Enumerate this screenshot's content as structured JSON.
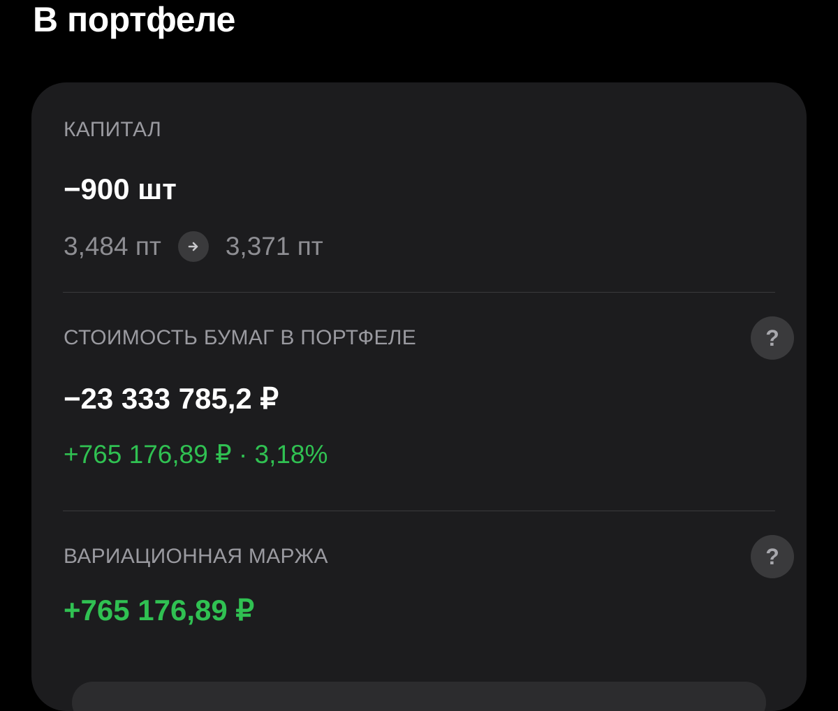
{
  "page": {
    "title": "В портфеле"
  },
  "capital": {
    "label": "КАПИТАЛ",
    "quantity": "−900 шт",
    "from_points": "3,484 пт",
    "to_points": "3,371 пт",
    "arrow_icon": "arrow-right-icon"
  },
  "securities_value": {
    "label": "СТОИМОСТЬ БУМАГ В ПОРТФЕЛЕ",
    "value": "−23 333 785,2 ₽",
    "change": "+765 176,89 ₽ · 3,18%",
    "help_symbol": "?"
  },
  "variation_margin": {
    "label": "ВАРИАЦИОННАЯ МАРЖА",
    "value": "+765 176,89 ₽",
    "help_symbol": "?"
  },
  "colors": {
    "background": "#000000",
    "card": "#1c1c1e",
    "positive": "#30c152",
    "secondary_text": "#8e8e93"
  }
}
